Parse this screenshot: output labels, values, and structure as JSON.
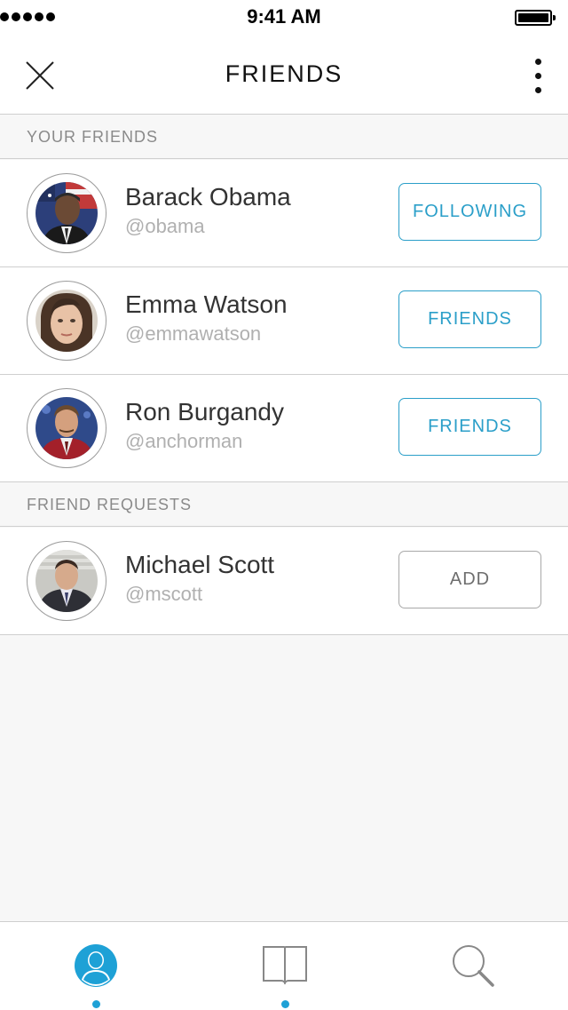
{
  "status_bar": {
    "time": "9:41 AM",
    "signal_bars": 5
  },
  "nav": {
    "title": "FRIENDS",
    "close_icon": "close-icon",
    "more_icon": "more-vertical-icon"
  },
  "sections": {
    "friends_header": "YOUR FRIENDS",
    "requests_header": "FRIEND REQUESTS"
  },
  "friends": [
    {
      "name": "Barack Obama",
      "handle": "@obama",
      "action": "FOLLOWING"
    },
    {
      "name": "Emma Watson",
      "handle": "@emmawatson",
      "action": "FRIENDS"
    },
    {
      "name": "Ron Burgandy",
      "handle": "@anchorman",
      "action": "FRIENDS"
    }
  ],
  "requests": [
    {
      "name": "Michael Scott",
      "handle": "@mscott",
      "action": "ADD"
    }
  ],
  "tab_bar": {
    "tabs": [
      {
        "icon": "person-icon",
        "active": true,
        "dot": true
      },
      {
        "icon": "book-icon",
        "active": false,
        "dot": true
      },
      {
        "icon": "search-icon",
        "active": false,
        "dot": false
      }
    ]
  },
  "colors": {
    "accent": "#2b9fc9",
    "tab_active": "#1ea1d6",
    "separator": "#cfcfcf",
    "background": "#f7f7f7"
  }
}
